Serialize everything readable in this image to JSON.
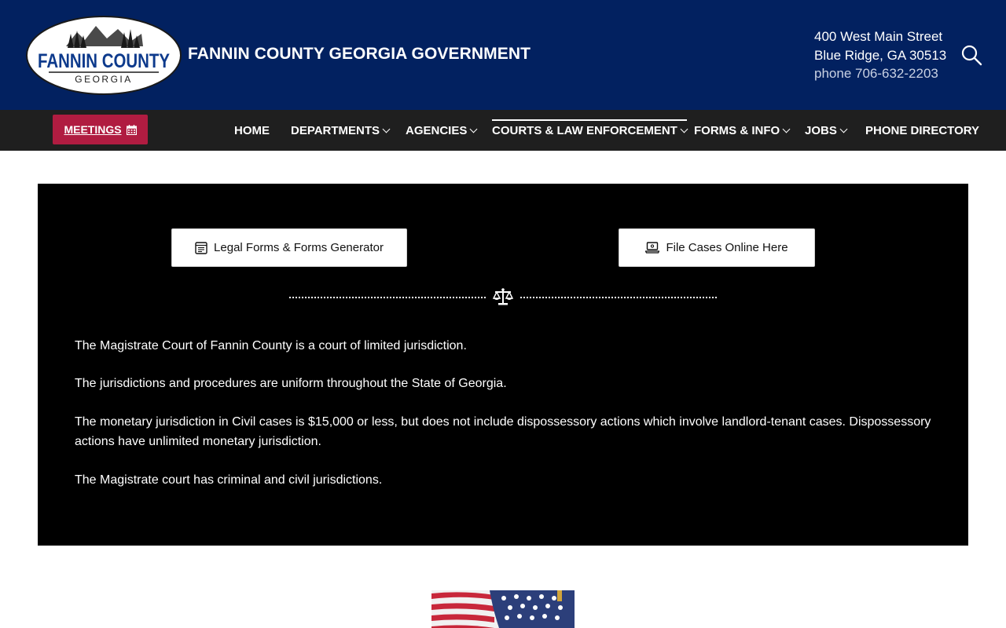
{
  "header": {
    "logo": {
      "name": "FANNIN COUNTY",
      "sub": "GEORGIA"
    },
    "site_title": "FANNIN COUNTY GEORGIA GOVERNMENT",
    "address_line1": "400 West Main Street",
    "address_line2": "Blue Ridge, GA 30513",
    "phone": "phone 706-632-2203",
    "search_icon": "search-icon"
  },
  "nav": {
    "meetings_label": "MEETINGS",
    "meetings_icon": "calendar-icon",
    "items": [
      {
        "label": "HOME"
      },
      {
        "label": "DEPARTMENTS"
      },
      {
        "label": "AGENCIES"
      },
      {
        "label": "COURTS & LAW ENFORCEMENT"
      },
      {
        "label": "FORMS & INFO"
      },
      {
        "label": "JOBS"
      },
      {
        "label": "PHONE DIRECTORY"
      }
    ]
  },
  "main": {
    "buttons": [
      {
        "label": "Legal Forms & Forms Generator",
        "icon": "form-icon"
      },
      {
        "label": "File Cases Online Here",
        "icon": "laptop-icon"
      }
    ],
    "divider_icon": "scales-of-justice-icon",
    "paragraphs": [
      "The Magistrate Court of Fannin County is a court of limited jurisdiction.",
      "The jurisdictions and procedures are uniform throughout the State of Georgia.",
      "The monetary jurisdiction in Civil cases is $15,000 or less, but does not include dispossessory actions which involve landlord-tenant cases. Dispossessory actions have unlimited monetary jurisdiction.",
      "The Magistrate court has criminal and civil jurisdictions."
    ]
  },
  "colors": {
    "header_bg": "#022160",
    "nav_bg": "#1f1f1f",
    "meetings_bg": "#b01c41",
    "panel_bg": "#000000"
  }
}
